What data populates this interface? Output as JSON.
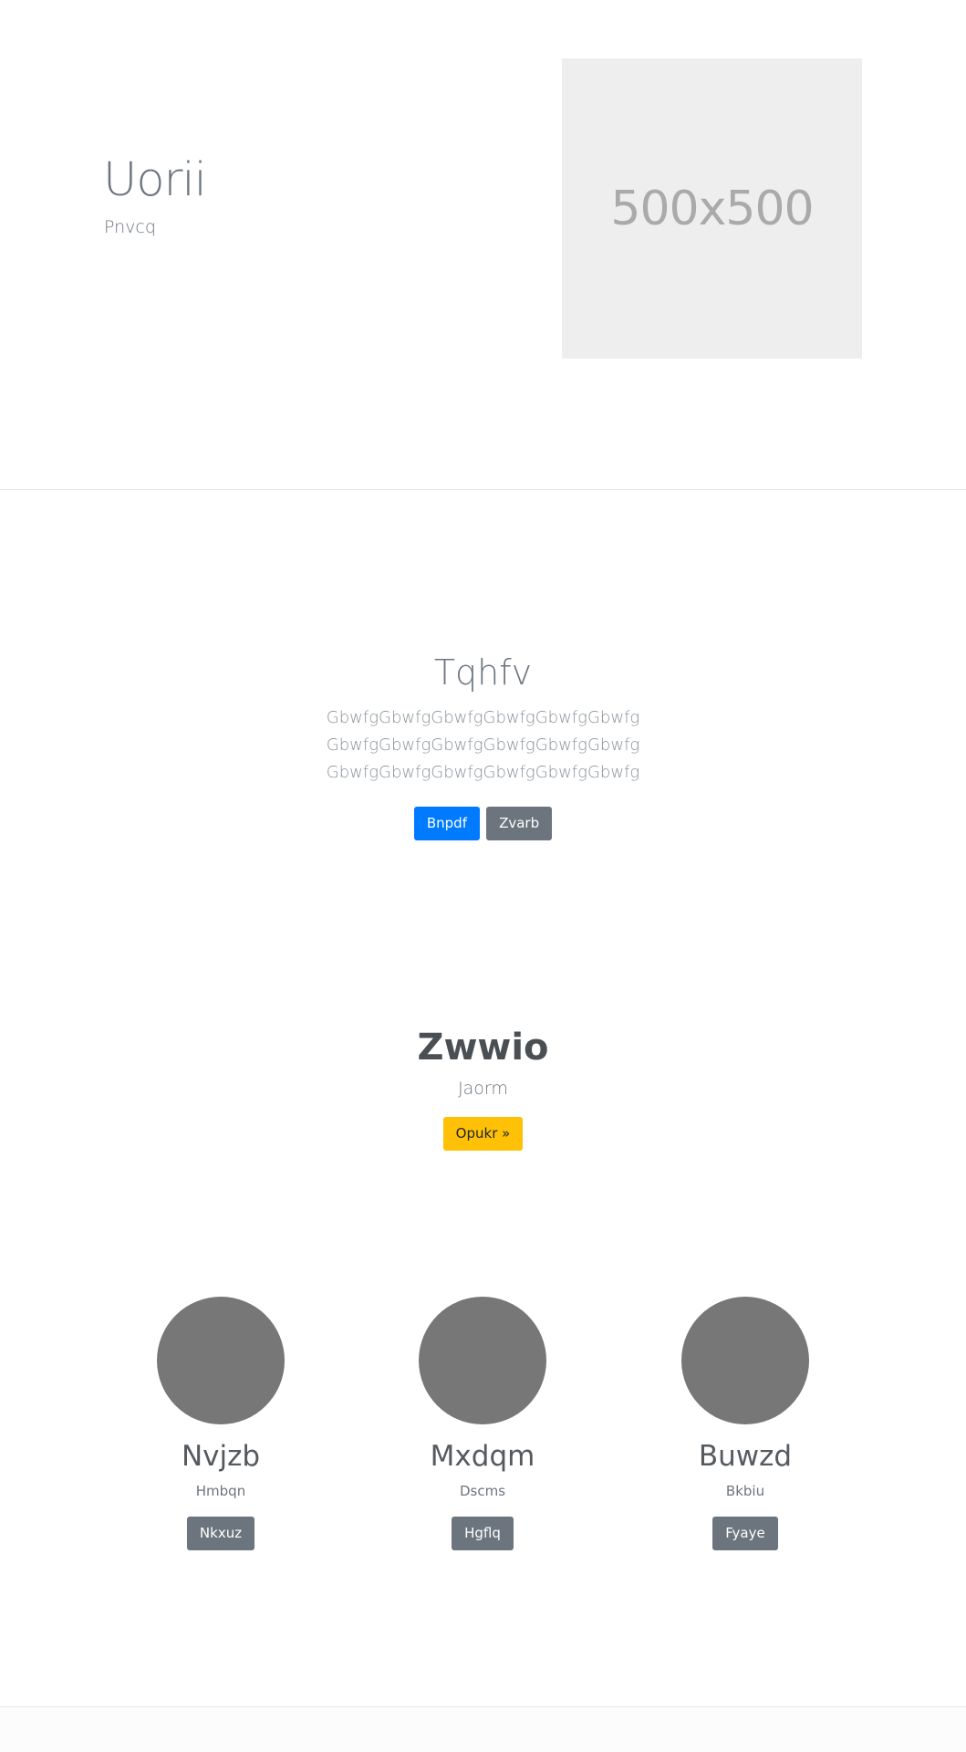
{
  "hero": {
    "title": "Uorii",
    "subtitle": "Pnvcq",
    "image_label": "500x500"
  },
  "feature": {
    "title": "Tqhfv",
    "lines": [
      "GbwfgGbwfgGbwfgGbwfgGbwfgGbwfg",
      "GbwfgGbwfgGbwfgGbwfgGbwfgGbwfg",
      "GbwfgGbwfgGbwfgGbwfgGbwfgGbwfg"
    ],
    "primary_button": "Bnpdf",
    "secondary_button": "Zvarb"
  },
  "cta": {
    "title": "Zwwio",
    "subtitle": "Jaorm",
    "button": "Opukr »"
  },
  "team": [
    {
      "name": "Nvjzb",
      "role": "Hmbqn",
      "button": "Nkxuz"
    },
    {
      "name": "Mxdqm",
      "role": "Dscms",
      "button": "Hgflq"
    },
    {
      "name": "Buwzd",
      "role": "Bkbiu",
      "button": "Fyaye"
    }
  ],
  "colors": {
    "primary": "#007bff",
    "secondary": "#6c757d",
    "warning": "#ffc107",
    "avatar": "#777777",
    "placeholder_bg": "#eeeeee"
  }
}
